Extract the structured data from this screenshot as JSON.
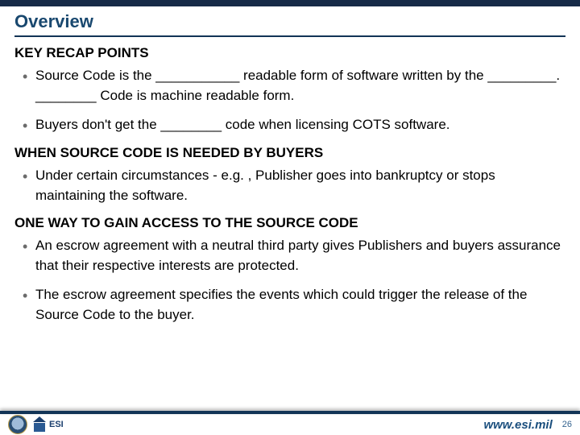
{
  "title": "Overview",
  "sections": {
    "recap": {
      "heading": "KEY RECAP POINTS",
      "items": [
        "Source Code is the ___________ readable form of software written by the _________.  ________ Code is machine readable form.",
        "Buyers don't get the ________ code when licensing COTS software."
      ]
    },
    "needed": {
      "heading": "WHEN SOURCE CODE IS NEEDED BY BUYERS",
      "items": [
        "Under certain circumstances  - e.g. , Publisher goes into bankruptcy or stops maintaining the software."
      ]
    },
    "gain": {
      "heading": "ONE WAY TO GAIN ACCESS TO THE SOURCE CODE",
      "items": [
        "An escrow agreement with a neutral third party gives Publishers and buyers assurance that their respective interests are protected.",
        "The escrow agreement specifies the events which could trigger the release of the Source Code to the buyer."
      ]
    }
  },
  "footer": {
    "url": "www.esi.mil",
    "page": "26",
    "logos": {
      "seal": "dod-seal",
      "esi": "DoD ESI"
    }
  }
}
